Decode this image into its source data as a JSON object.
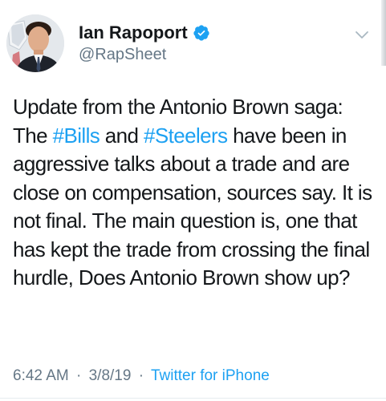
{
  "tweet": {
    "author": {
      "display_name": "Ian Rapoport",
      "handle": "@RapSheet",
      "avatar_icon": "profile-photo",
      "verified_icon": "verified-badge-icon",
      "verified_color": "#1da1f2"
    },
    "caret_icon": "chevron-down-icon",
    "text": {
      "part_1": "Update from the Antonio Brown saga: The ",
      "hashtag_1": "#Bills",
      "part_2": " and ",
      "hashtag_2": "#Steelers",
      "part_3": " have been in aggressive talks about a trade and are close on compensation, sources say. It is not final. The main question is, one that has kept the trade from crossing the final hurdle, Does Antonio Brown show up?"
    },
    "meta": {
      "time": "6:42 AM",
      "separator_1": "·",
      "date": "3/8/19",
      "separator_2": "·",
      "source": "Twitter for iPhone"
    }
  },
  "colors": {
    "link": "#1da1f2",
    "text": "#14171a",
    "secondary": "#657786"
  }
}
